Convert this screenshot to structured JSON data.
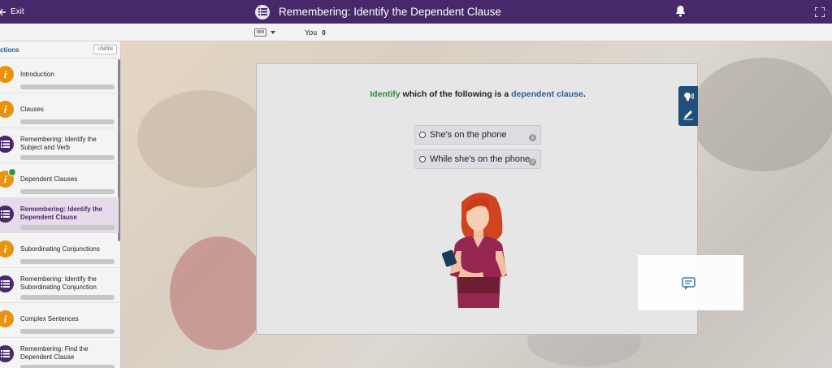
{
  "topbar": {
    "exit_label": "Exit",
    "title": "Remembering: Identify the Dependent Clause",
    "icons": [
      "exit-icon",
      "list-icon",
      "bell-icon",
      "fullscreen-icon"
    ]
  },
  "subbar": {
    "badge_text": "888",
    "user_label": "You",
    "score": "0"
  },
  "sidebar": {
    "title": "ctions",
    "unpin_label": "UNPIN",
    "items": [
      {
        "label": "Introduction",
        "icon": "info-icon",
        "progress": 0
      },
      {
        "label": "Clauses",
        "icon": "info-icon",
        "progress": 0
      },
      {
        "label": "Remembering: Identify the Subject and Verb",
        "icon": "list-icon",
        "progress": 0
      },
      {
        "label": "Dependent Clauses",
        "icon": "info-icon",
        "progress": 1,
        "completed": true
      },
      {
        "label": "Remembering: Identify the Dependent Clause",
        "icon": "list-icon",
        "progress": 0,
        "active": true
      },
      {
        "label": "Subordinating Conjunctions",
        "icon": "info-icon",
        "progress": 0
      },
      {
        "label": "Remembering: Identify the Subordinating Conjunction",
        "icon": "list-icon",
        "progress": 0
      },
      {
        "label": "Complex Sentences",
        "icon": "info-icon",
        "progress": 0
      },
      {
        "label": "Remembering: Find the Dependent Clause",
        "icon": "list-icon",
        "progress": 0
      }
    ]
  },
  "question": {
    "verb": "Identify",
    "middle": " which of the following is a ",
    "term": "dependent clause",
    "end": "."
  },
  "options": [
    {
      "label": "She's on the phone",
      "num": "1"
    },
    {
      "label": "While she's on the phone",
      "num": "2"
    }
  ],
  "colors": {
    "brand": "#47296b",
    "accent_blue": "#1f4f7a",
    "success": "#1f8a3a",
    "info": "#e8930b"
  }
}
